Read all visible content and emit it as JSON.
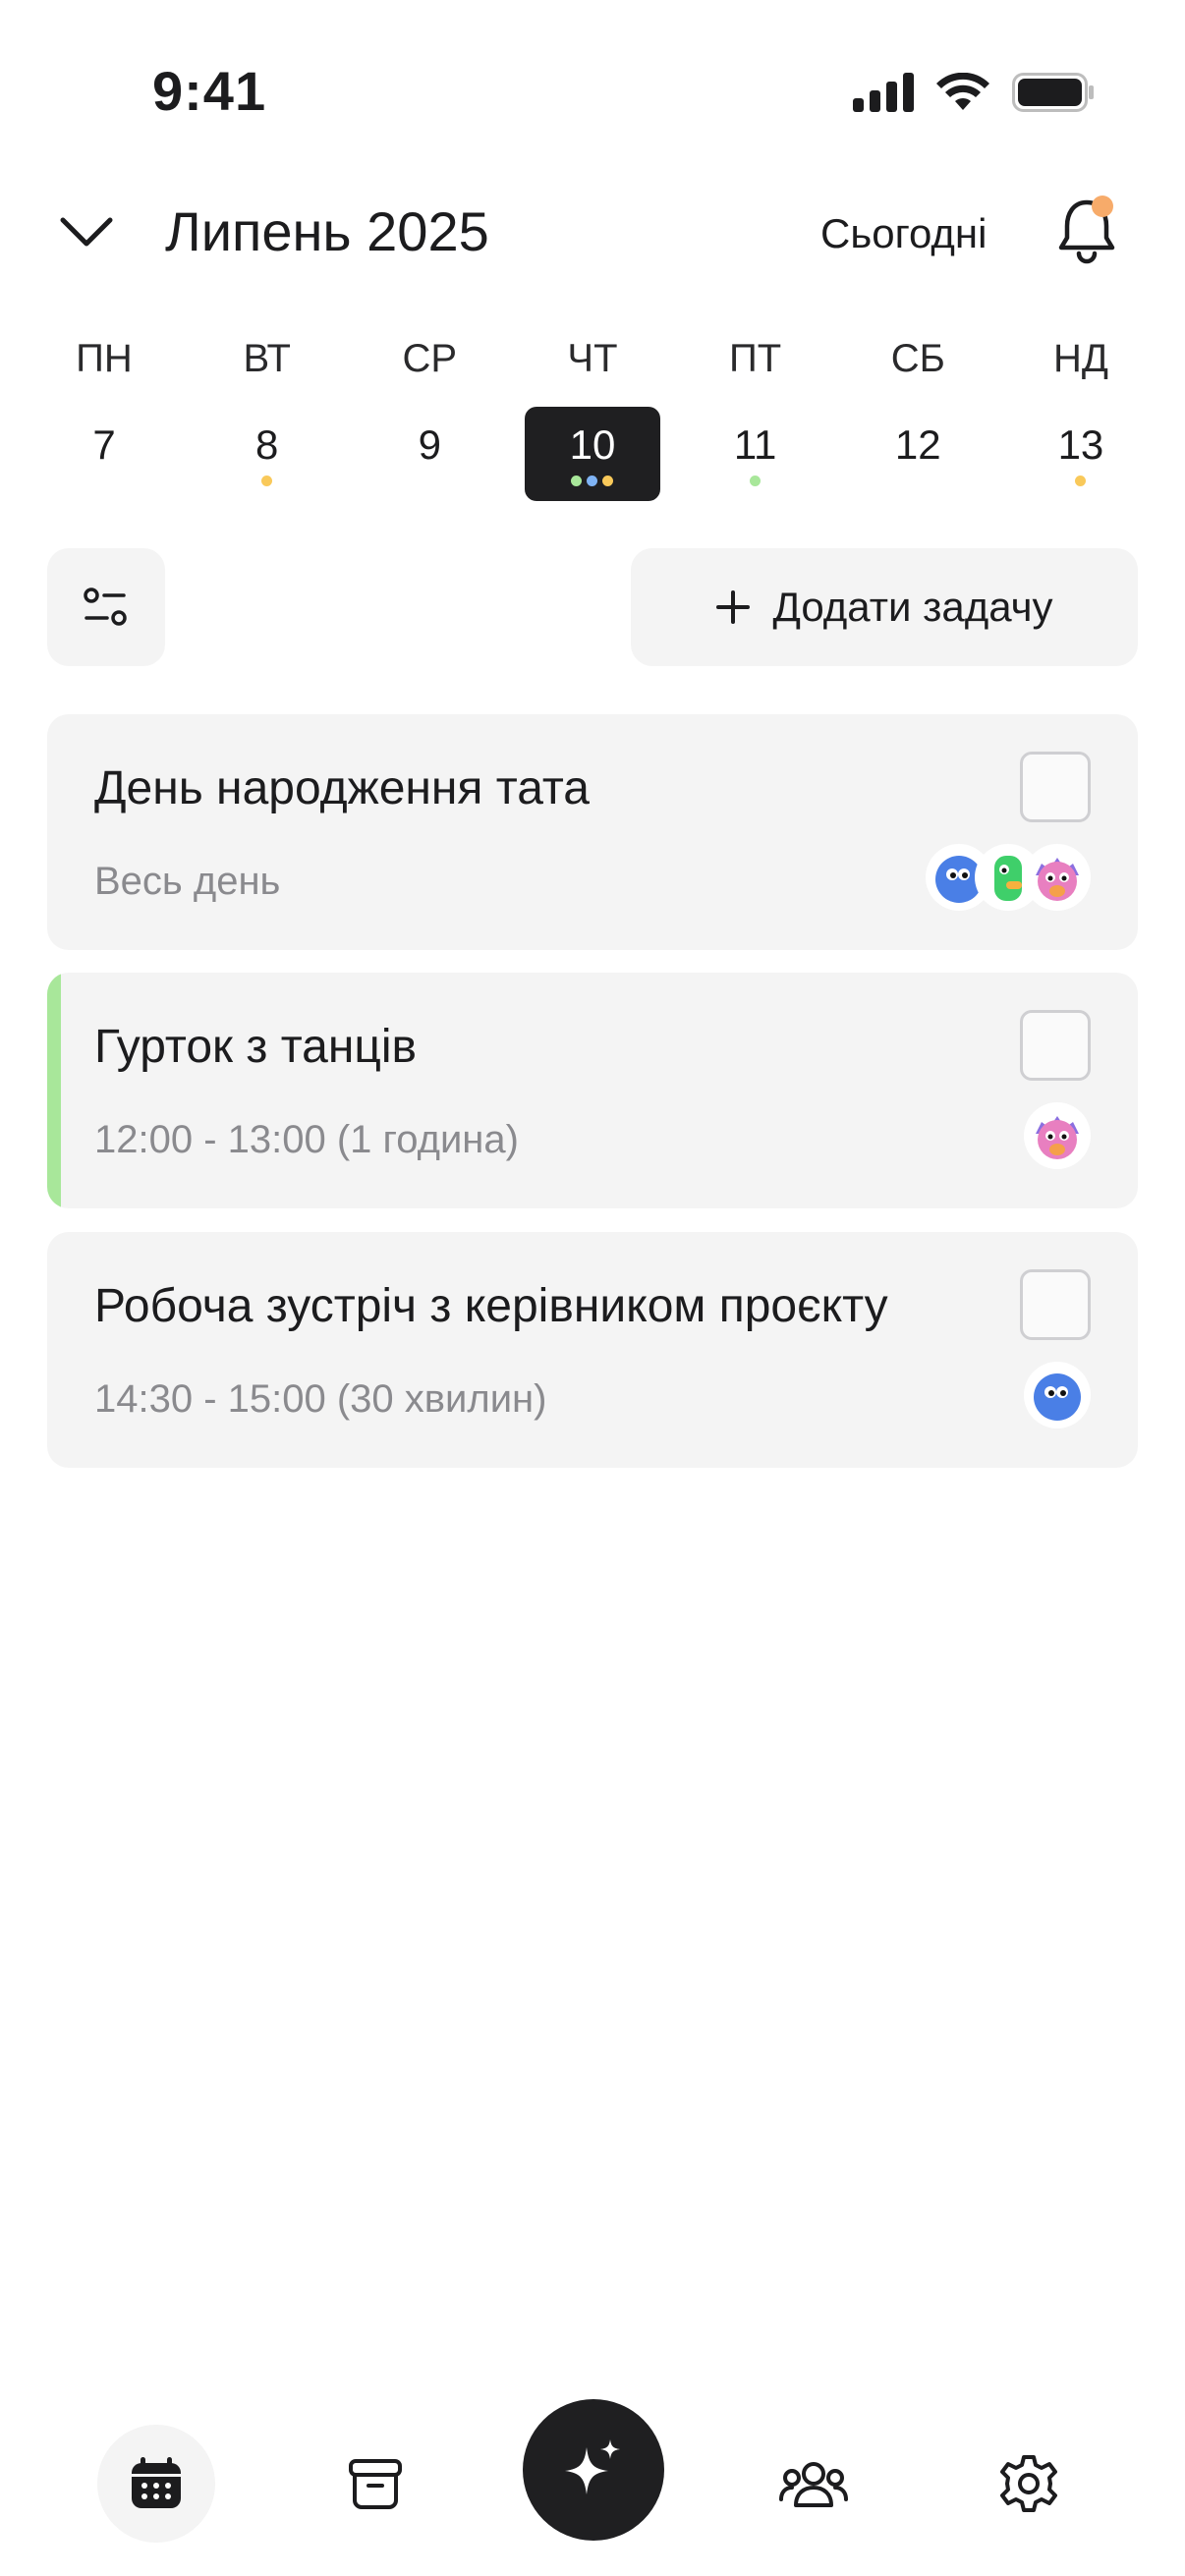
{
  "status_bar": {
    "time": "9:41"
  },
  "header": {
    "month_title": "Липень 2025",
    "today_label": "Сьогодні"
  },
  "week": {
    "days": [
      {
        "dow": "ПН",
        "date": "7",
        "dots": []
      },
      {
        "dow": "ВТ",
        "date": "8",
        "dots": [
          "#f9c95a"
        ]
      },
      {
        "dow": "СР",
        "date": "9",
        "dots": []
      },
      {
        "dow": "ЧТ",
        "date": "10",
        "dots": [
          "#a8e79a",
          "#7fb3f5",
          "#f9c95a"
        ],
        "selected": true
      },
      {
        "dow": "ПТ",
        "date": "11",
        "dots": [
          "#a8e79a"
        ]
      },
      {
        "dow": "СБ",
        "date": "12",
        "dots": []
      },
      {
        "dow": "НД",
        "date": "13",
        "dots": [
          "#f9c95a"
        ]
      }
    ]
  },
  "toolbar": {
    "add_task_label": "Додати задачу"
  },
  "tasks": [
    {
      "title": "День народження тата",
      "subtitle": "Весь день",
      "avatars": [
        "blue-monster",
        "green-monster",
        "pink-monster"
      ]
    },
    {
      "title": "Гурток з танців",
      "subtitle": "12:00 - 13:00 (1 година)",
      "avatars": [
        "pink-monster"
      ],
      "accent": "#a8e79a"
    },
    {
      "title": "Робоча зустріч з керівником проєкту",
      "subtitle": "14:30 - 15:00 (30 хвилин)",
      "avatars": [
        "blue-monster"
      ]
    }
  ],
  "tabbar": {
    "items": [
      "calendar-icon",
      "archive-icon",
      "sparkle-icon",
      "family-icon",
      "settings-icon"
    ],
    "selected": "calendar-icon"
  },
  "colors": {
    "accent_green": "#a8e79a",
    "notification": "#f7ab6a",
    "dark": "#1f1f21",
    "card": "#f4f4f4"
  }
}
